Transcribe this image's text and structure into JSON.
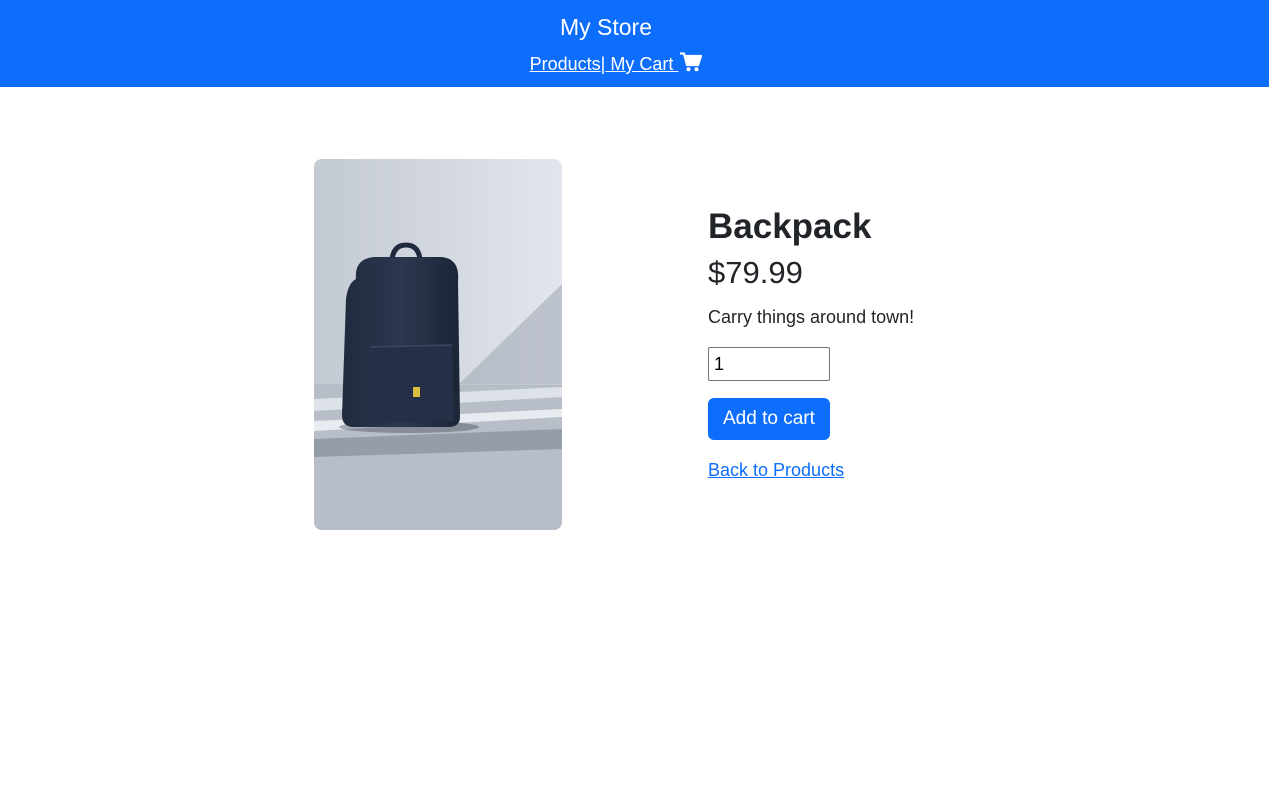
{
  "header": {
    "store_title": "My Store",
    "products_link": "Products",
    "separator": "|",
    "cart_link": " My Cart ",
    "cart_icon": "shopping-cart-icon",
    "background_color": "#0d6efd"
  },
  "product": {
    "name": "Backpack",
    "price": "$79.99",
    "description": "Carry things around town!",
    "quantity": "1",
    "add_to_cart_label": "Add to cart",
    "back_link": "Back to Products"
  }
}
